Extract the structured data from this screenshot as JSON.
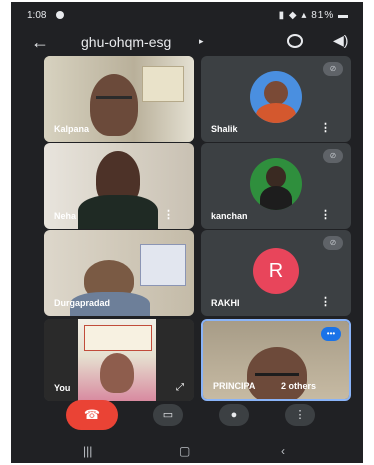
{
  "status_bar": {
    "time": "1:08",
    "right_text": "81%"
  },
  "meeting": {
    "title": "ghu-ohqm-esg"
  },
  "tiles": [
    {
      "name": "Kalpana"
    },
    {
      "name": "Shalik"
    },
    {
      "name": "Neha"
    },
    {
      "name": "kanchan"
    },
    {
      "name": "Durgapradad"
    },
    {
      "name": "RAKHI",
      "initial": "R"
    },
    {
      "name": "You"
    },
    {
      "name": "PRINCIPA",
      "others": "2 others"
    }
  ],
  "colors": {
    "end_call": "#ea4335",
    "rakhi_avatar": "#e8455b",
    "shalik_avatar": "#4a8fe0",
    "kanchan_avatar": "#2f8f3d"
  },
  "icons": [
    "back-arrow-icon",
    "camera-switch-icon",
    "speaker-icon",
    "mic-off-icon",
    "kebab-menu-icon",
    "hangup-icon",
    "video-icon",
    "mic-icon",
    "more-icon"
  ]
}
